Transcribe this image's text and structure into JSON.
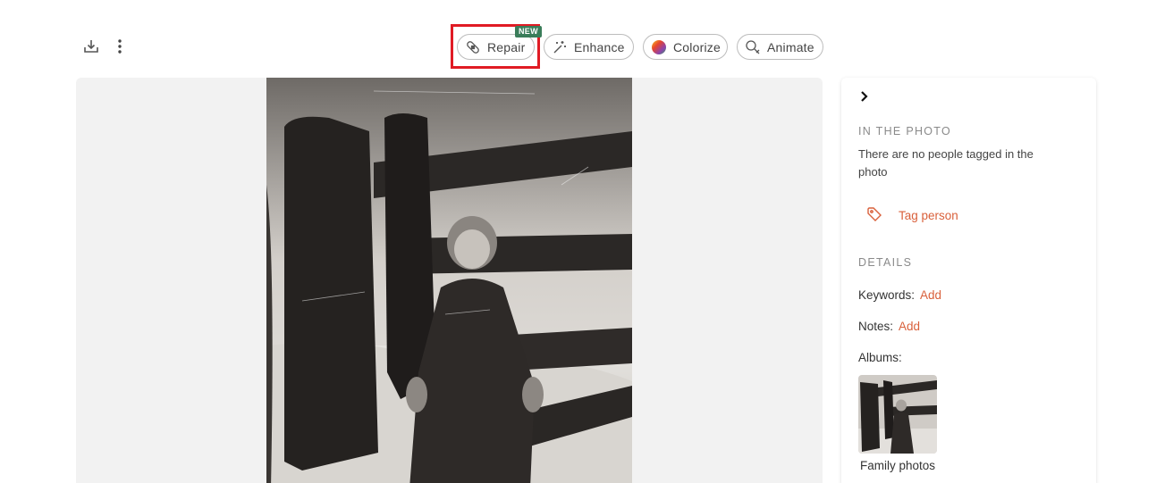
{
  "toolbar": {
    "download_icon": "download-icon",
    "more_icon": "more-vertical-icon"
  },
  "tools": {
    "repair": {
      "label": "Repair",
      "icon": "bandage-icon",
      "badge": "NEW"
    },
    "enhance": {
      "label": "Enhance",
      "icon": "magic-wand-icon"
    },
    "colorize": {
      "label": "Colorize",
      "icon": "color-wheel-icon"
    },
    "animate": {
      "label": "Animate",
      "icon": "animate-icon"
    }
  },
  "colors": {
    "accent": "#d9603b",
    "highlight": "#e01b24",
    "badge": "#3a7d5a"
  },
  "panel": {
    "collapse_icon": "chevron-right-icon",
    "in_photo": {
      "title": "IN THE PHOTO",
      "empty_text": "There are no people tagged in the photo",
      "tag_label": "Tag person",
      "tag_icon": "tag-icon"
    },
    "details": {
      "title": "DETAILS",
      "keywords_label": "Keywords:",
      "keywords_action": "Add",
      "notes_label": "Notes:",
      "notes_action": "Add",
      "albums_label": "Albums:",
      "albums": [
        {
          "name": "Family photos"
        }
      ]
    }
  }
}
